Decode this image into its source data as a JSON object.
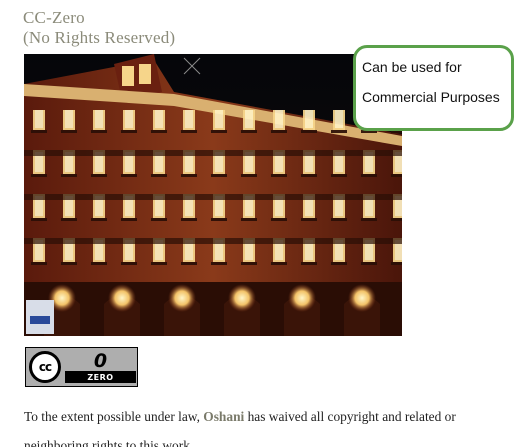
{
  "license": {
    "title_line1": "CC-Zero",
    "title_line2": "(No Rights Reserved)"
  },
  "photo": {
    "description_name": "lit-building-night-photo"
  },
  "callout": {
    "line1": "Can be used for",
    "line2": "Commercial Purposes",
    "border_color": "#5aa14a"
  },
  "badge": {
    "cc_text": "cc",
    "zero_glyph": "0",
    "zero_word": "ZERO"
  },
  "waiver": {
    "prefix": "To the extent possible under law, ",
    "holder": "Oshani",
    "suffix": " has waived all copyright and related or",
    "line2": "neighboring rights to this work."
  },
  "colors": {
    "title": "#8b8b7a",
    "holder": "#7a7a6a"
  }
}
